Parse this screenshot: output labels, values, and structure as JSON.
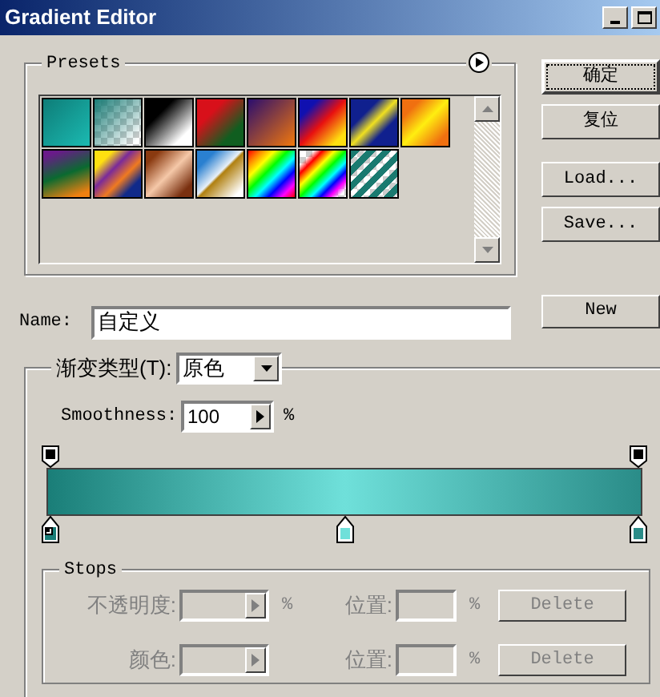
{
  "window": {
    "title": "Gradient Editor"
  },
  "presets": {
    "title": "Presets",
    "swatches": [
      {
        "kind": "teal"
      },
      {
        "kind": "teal-transparent"
      },
      {
        "kind": "black-white"
      },
      {
        "kind": "red-green"
      },
      {
        "kind": "violet-orange"
      },
      {
        "kind": "blue-red-yellow"
      },
      {
        "kind": "blue-yellow-blue"
      },
      {
        "kind": "orange-yellow-orange"
      },
      {
        "kind": "violet-green-orange"
      },
      {
        "kind": "yellow-violet-orange-blue"
      },
      {
        "kind": "copper"
      },
      {
        "kind": "chrome"
      },
      {
        "kind": "spectrum"
      },
      {
        "kind": "transparent-rainbow"
      },
      {
        "kind": "transparent-stripes"
      }
    ]
  },
  "buttons": [
    {
      "label": "确定",
      "focused": true
    },
    {
      "label": "复位",
      "focused": false
    },
    {
      "label": "Load...",
      "focused": false
    },
    {
      "label": "Save...",
      "focused": false
    }
  ],
  "name": {
    "label": "Name:",
    "value": "自定义"
  },
  "new_button": "New",
  "gradient": {
    "type_label": "渐变类型(T):",
    "type_value": "原色",
    "smoothness_label": "Smoothness:",
    "smoothness_value": "100",
    "smoothness_unit": "%",
    "opacity_stops": [
      {
        "color": "#000000"
      },
      {
        "color": "#000000"
      }
    ],
    "color_stops": [
      {
        "kind": "foreground",
        "color": "#1a7e78"
      },
      {
        "kind": "color",
        "color": "#6fe0da"
      },
      {
        "kind": "color",
        "color": "#2a8c88"
      }
    ]
  },
  "stops": {
    "title": "Stops",
    "rows": [
      {
        "label": "不透明度:",
        "unit": "%",
        "position_label": "位置:",
        "position_unit": "%",
        "button": "Delete",
        "disabled": true
      },
      {
        "label": "颜色:",
        "unit": "",
        "position_label": "位置:",
        "position_unit": "%",
        "button": "Delete",
        "disabled": true
      }
    ]
  }
}
